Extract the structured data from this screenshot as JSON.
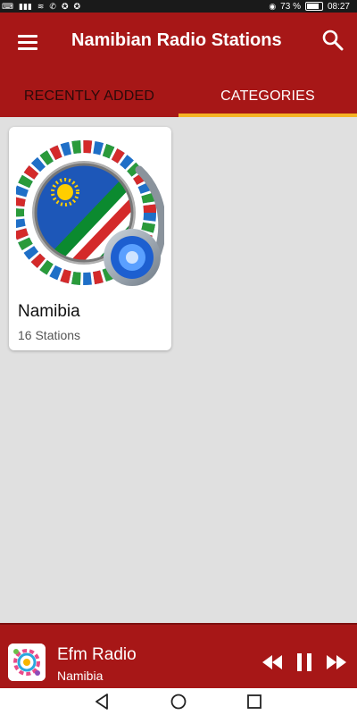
{
  "status_bar": {
    "battery_percent": "73 %",
    "time": "08:27",
    "icons": [
      "keyboard-icon",
      "signal-icon",
      "wifi-icon",
      "notification-icon",
      "eye-icon",
      "battery-icon"
    ]
  },
  "app_bar": {
    "title": "Namibian Radio Stations",
    "menu_icon": "hamburger-menu-icon",
    "search_icon": "search-icon",
    "background_color": "#a71717"
  },
  "tabs": [
    {
      "label": "RECENTLY ADDED",
      "selected": false
    },
    {
      "label": "CATEGORIES",
      "selected": true
    }
  ],
  "tab_indicator_color": "#f4b324",
  "categories": [
    {
      "name": "Namibia",
      "count_label": "16 Stations",
      "image": "namibia-flag-headphones-icon"
    }
  ],
  "player": {
    "station": "Efm Radio",
    "country": "Namibia",
    "state": "playing",
    "controls": [
      "rewind-icon",
      "pause-icon",
      "fast-forward-icon"
    ]
  },
  "nav_bar": {
    "buttons": [
      "back-icon",
      "home-icon",
      "recents-icon"
    ]
  }
}
